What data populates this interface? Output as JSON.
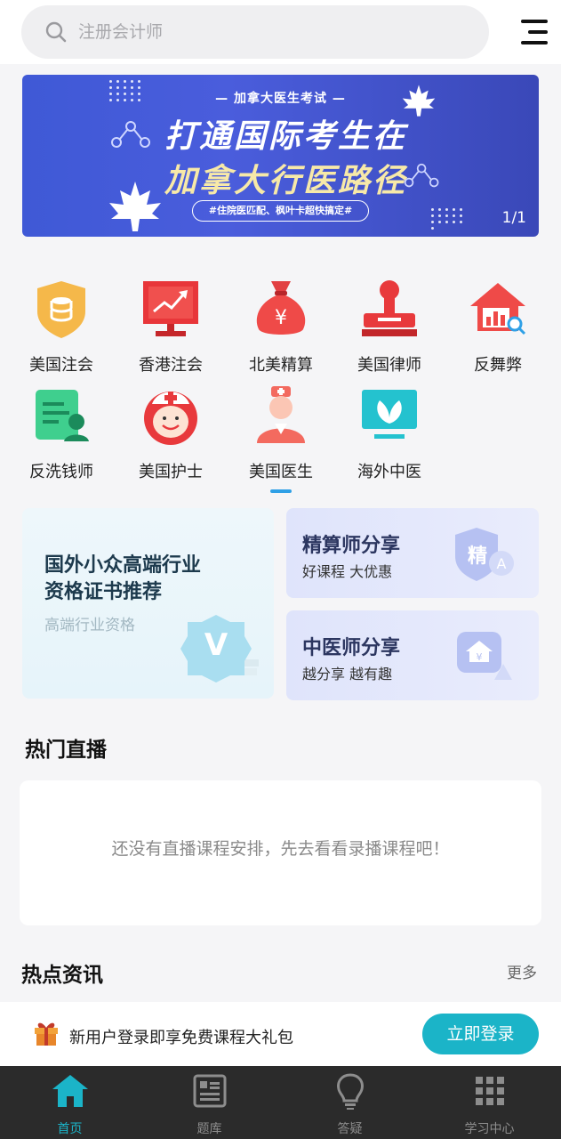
{
  "search": {
    "placeholder": "注册会计师"
  },
  "banner": {
    "subtitle": "— 加拿大医生考试 —",
    "line1": "打通国际考生在",
    "line2": "加拿大行医路径",
    "tagline": "#住院医匹配、枫叶卡超快搞定#",
    "counter": "1/1"
  },
  "categories": [
    {
      "label": "美国注会",
      "icon": "shield-coins-icon"
    },
    {
      "label": "香港注会",
      "icon": "chart-monitor-icon"
    },
    {
      "label": "北美精算",
      "icon": "money-bag-icon"
    },
    {
      "label": "美国律师",
      "icon": "stamp-icon"
    },
    {
      "label": "反舞弊",
      "icon": "house-search-icon"
    },
    {
      "label": "反洗钱师",
      "icon": "document-person-icon"
    },
    {
      "label": "美国护士",
      "icon": "nurse-icon"
    },
    {
      "label": "美国医生",
      "icon": "doctor-icon"
    },
    {
      "label": "海外中医",
      "icon": "leaf-screen-icon"
    }
  ],
  "promo": {
    "big": {
      "line1": "国外小众高端行业",
      "line2": "资格证书推荐",
      "subtitle": "高端行业资格",
      "badge": "V"
    },
    "actuary": {
      "title": "精算师分享",
      "subtitle": "好课程 大优惠",
      "badge": "精"
    },
    "tcm": {
      "title": "中医师分享",
      "subtitle": "越分享 越有趣"
    }
  },
  "live": {
    "title": "热门直播",
    "empty_text": "还没有直播课程安排，先去看看录播课程吧！"
  },
  "news": {
    "title": "热点资讯",
    "more": "更多"
  },
  "login_bar": {
    "text": "新用户登录即享免费课程大礼包",
    "button": "立即登录"
  },
  "tabs": [
    {
      "label": "首页",
      "icon": "home-icon",
      "active": true
    },
    {
      "label": "题库",
      "icon": "question-bank-icon",
      "active": false
    },
    {
      "label": "答疑",
      "icon": "lightbulb-icon",
      "active": false
    },
    {
      "label": "学习中心",
      "icon": "grid-icon",
      "active": false
    }
  ],
  "colors": {
    "accent": "#1bb4c8",
    "banner": "#4a5ddc",
    "tab_bg": "#2b2b2b"
  }
}
